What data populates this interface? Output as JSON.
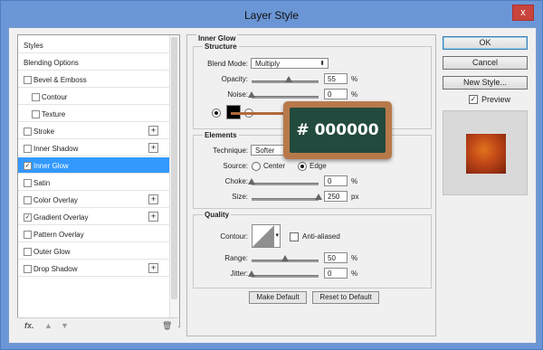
{
  "window": {
    "title": "Layer Style",
    "close_glyph": "x"
  },
  "styles_list": {
    "items": [
      {
        "label": "Styles",
        "checkbox": false,
        "checked": false,
        "plus": false,
        "sub": false,
        "selected": false
      },
      {
        "label": "Blending Options",
        "checkbox": false,
        "checked": false,
        "plus": false,
        "sub": false,
        "selected": false
      },
      {
        "label": "Bevel & Emboss",
        "checkbox": true,
        "checked": false,
        "plus": false,
        "sub": false,
        "selected": false
      },
      {
        "label": "Contour",
        "checkbox": true,
        "checked": false,
        "plus": false,
        "sub": true,
        "selected": false
      },
      {
        "label": "Texture",
        "checkbox": true,
        "checked": false,
        "plus": false,
        "sub": true,
        "selected": false
      },
      {
        "label": "Stroke",
        "checkbox": true,
        "checked": false,
        "plus": true,
        "sub": false,
        "selected": false
      },
      {
        "label": "Inner Shadow",
        "checkbox": true,
        "checked": false,
        "plus": true,
        "sub": false,
        "selected": false
      },
      {
        "label": "Inner Glow",
        "checkbox": true,
        "checked": true,
        "plus": false,
        "sub": false,
        "selected": true
      },
      {
        "label": "Satin",
        "checkbox": true,
        "checked": false,
        "plus": false,
        "sub": false,
        "selected": false
      },
      {
        "label": "Color Overlay",
        "checkbox": true,
        "checked": false,
        "plus": true,
        "sub": false,
        "selected": false
      },
      {
        "label": "Gradient Overlay",
        "checkbox": true,
        "checked": true,
        "plus": true,
        "sub": false,
        "selected": false
      },
      {
        "label": "Pattern Overlay",
        "checkbox": true,
        "checked": false,
        "plus": false,
        "sub": false,
        "selected": false
      },
      {
        "label": "Outer Glow",
        "checkbox": true,
        "checked": false,
        "plus": false,
        "sub": false,
        "selected": false
      },
      {
        "label": "Drop Shadow",
        "checkbox": true,
        "checked": false,
        "plus": true,
        "sub": false,
        "selected": false
      }
    ],
    "footer": {
      "fx": "fx.",
      "up": "▲",
      "down": "▼",
      "trash": "🗑"
    }
  },
  "inner_glow": {
    "section_title": "Inner Glow",
    "structure": {
      "title": "Structure",
      "blend_mode_label": "Blend Mode:",
      "blend_mode_value": "Multiply",
      "opacity_label": "Opacity:",
      "opacity_value": "55",
      "opacity_level": 0.55,
      "noise_label": "Noise:",
      "noise_value": "0",
      "noise_level": 0,
      "percent": "%"
    },
    "elements": {
      "title": "Elements",
      "technique_label": "Technique:",
      "technique_value": "Softer",
      "source_label": "Source:",
      "source_center": "Center",
      "source_edge": "Edge",
      "choke_label": "Choke:",
      "choke_value": "0",
      "choke_level": 0,
      "size_label": "Size:",
      "size_value": "250",
      "size_level": 1,
      "percent": "%",
      "px": "px"
    },
    "quality": {
      "title": "Quality",
      "contour_label": "Contour:",
      "anti_aliased_label": "Anti-aliased",
      "range_label": "Range:",
      "range_value": "50",
      "range_level": 0.5,
      "jitter_label": "Jitter:",
      "jitter_value": "0",
      "jitter_level": 0,
      "percent": "%"
    },
    "make_default": "Make Default",
    "reset_to_default": "Reset to Default"
  },
  "actions": {
    "ok": "OK",
    "cancel": "Cancel",
    "new_style": "New Style...",
    "preview_label": "Preview",
    "preview_checked": true
  },
  "color_badge": {
    "text": "# 000000",
    "color": "#000000"
  }
}
